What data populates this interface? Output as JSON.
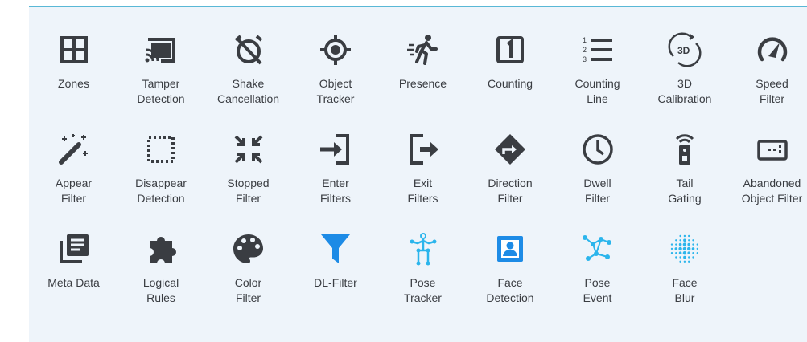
{
  "colors": {
    "icon": "#3a3d42",
    "blue": "#1d8be6",
    "cyan": "#2bb5ec",
    "panel": "#eef4fa",
    "border": "#59b8d6"
  },
  "tiles": [
    {
      "label": "Zones",
      "icon": "zones-icon"
    },
    {
      "label": "Tamper\nDetection",
      "icon": "cast-icon"
    },
    {
      "label": "Shake\nCancellation",
      "icon": "alarm-off-icon"
    },
    {
      "label": "Object\nTracker",
      "icon": "crosshair-icon"
    },
    {
      "label": "Presence",
      "icon": "walking-person-icon"
    },
    {
      "label": "Counting",
      "icon": "number-one-box-icon"
    },
    {
      "label": "Counting\nLine",
      "icon": "numbered-list-icon"
    },
    {
      "label": "3D\nCalibration",
      "icon": "3d-rotation-icon"
    },
    {
      "label": "Speed\nFilter",
      "icon": "speedometer-icon"
    },
    {
      "label": "Appear\nFilter",
      "icon": "magic-wand-icon"
    },
    {
      "label": "Disappear\nDetection",
      "icon": "dotted-square-icon"
    },
    {
      "label": "Stopped\nFilter",
      "icon": "shrink-arrows-icon"
    },
    {
      "label": "Enter\nFilters",
      "icon": "enter-icon"
    },
    {
      "label": "Exit\nFilters",
      "icon": "exit-icon"
    },
    {
      "label": "Direction\nFilter",
      "icon": "direction-sign-icon"
    },
    {
      "label": "Dwell\nFilter",
      "icon": "clock-icon"
    },
    {
      "label": "Tail\nGating",
      "icon": "access-reader-icon"
    },
    {
      "label": "Abandoned\nObject Filter",
      "icon": "abandoned-object-icon"
    },
    {
      "label": "Meta Data",
      "icon": "library-books-icon"
    },
    {
      "label": "Logical\nRules",
      "icon": "puzzle-piece-icon"
    },
    {
      "label": "Color\nFilter",
      "icon": "palette-icon"
    },
    {
      "label": "DL-Filter",
      "icon": "funnel-icon"
    },
    {
      "label": "Pose\nTracker",
      "icon": "pose-skeleton-icon"
    },
    {
      "label": "Face\nDetection",
      "icon": "face-portrait-icon"
    },
    {
      "label": "Pose\nEvent",
      "icon": "pose-network-icon"
    },
    {
      "label": "Face\nBlur",
      "icon": "face-blur-icon"
    }
  ]
}
